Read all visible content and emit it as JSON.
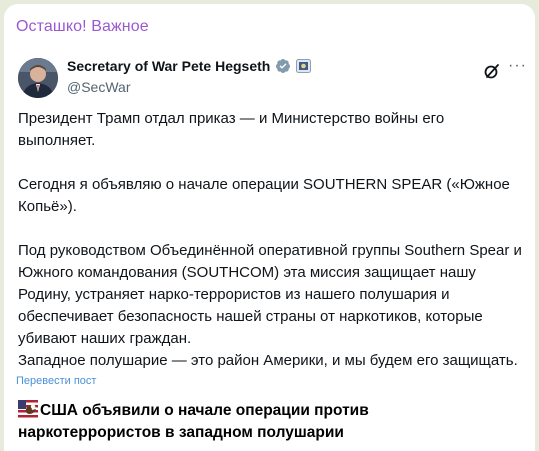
{
  "channel": {
    "name": "Осташко! Важное"
  },
  "tweet": {
    "display_name": "Secretary of War Pete Hegseth",
    "handle": "@SecWar",
    "paragraphs": [
      "Президент Трамп отдал приказ — и Министерство войны его выполняет.",
      "Сегодня я объявляю о начале операции SOUTHERN SPEAR («Южное Копьё»).",
      "Под руководством Объединённой оперативной группы Southern Spear и Южного командования (SOUTHCOM) эта миссия защищает нашу Родину, устраняет нарко-террористов из нашего полушария и обеспечивает безопасность нашей страны от наркотиков, которые убивают наших граждан.",
      "Западное полушарие — это район Америки, и мы будем его защищать."
    ],
    "more_label": "···"
  },
  "translate_link": "Перевести пост",
  "headline": "США объявили о начале операции против наркотеррористов в западном полушарии",
  "colors": {
    "channel_name": "#9b59d0",
    "verified": "#1d9bf0",
    "link": "#4a90d9"
  }
}
